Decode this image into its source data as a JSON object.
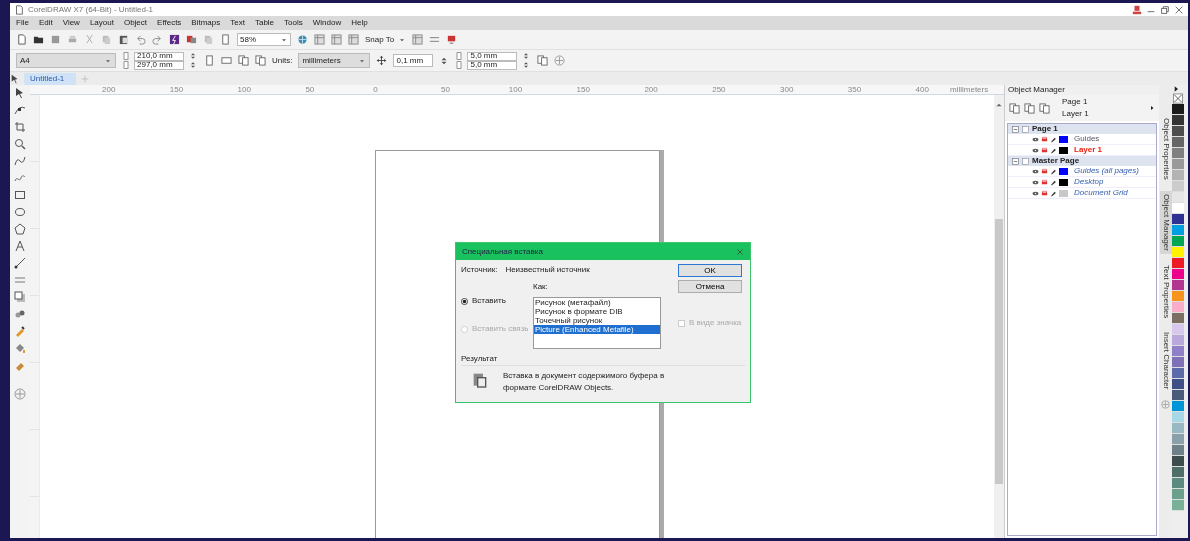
{
  "window": {
    "title": "CorelDRAW X7 (64-Bit) - Untitled-1"
  },
  "menu": [
    "File",
    "Edit",
    "View",
    "Layout",
    "Object",
    "Effects",
    "Bitmaps",
    "Text",
    "Table",
    "Tools",
    "Window",
    "Help"
  ],
  "toolbar": {
    "zoom": "58%",
    "snap_to": "Snap To"
  },
  "property_bar": {
    "page_size": "A4",
    "width": "210,0 mm",
    "height": "297,0 mm",
    "units_label": "Units:",
    "units": "millimeters",
    "nudge": "0,1 mm",
    "duplicate_x": "5,0 mm",
    "duplicate_y": "5,0 mm"
  },
  "document_tabs": [
    {
      "label": "Untitled-1",
      "selected": true
    }
  ],
  "ruler": {
    "labels": [
      "200",
      "150",
      "100",
      "50",
      "0",
      "50",
      "100",
      "150",
      "200",
      "250",
      "300",
      "350",
      "400"
    ],
    "unit": "millimeters"
  },
  "dialog": {
    "title": "Специальная вставка",
    "source_label": "Источник:",
    "source": "Неизвестный источник",
    "as_label": "Как:",
    "options": [
      {
        "label": "Вставить",
        "selected": true,
        "disabled": false
      },
      {
        "label": "Вставить связь",
        "selected": false,
        "disabled": true
      }
    ],
    "formats": [
      {
        "label": "Рисунок (метафайл)",
        "selected": false
      },
      {
        "label": "Рисунок в формате DIB",
        "selected": false
      },
      {
        "label": "Точечный рисунок",
        "selected": false
      },
      {
        "label": "Picture (Enhanced Metafile)",
        "selected": true
      }
    ],
    "as_icon": {
      "label": "В виде значка",
      "checked": false,
      "disabled": true
    },
    "buttons": [
      "OK",
      "Отмена"
    ],
    "result_label": "Результат",
    "result": "Вставка в документ содержимого буфера в формате CorelDRAW Objects."
  },
  "object_manager": {
    "title": "Object Manager",
    "current_page": "Page 1",
    "current_layer": "Layer 1",
    "pages": [
      {
        "name": "Page 1",
        "children": [
          {
            "name": "Guides",
            "kind": "layer",
            "active": false,
            "color": "#0000ff"
          },
          {
            "name": "Layer 1",
            "kind": "layer",
            "active": true,
            "color": "#000000"
          }
        ]
      },
      {
        "name": "Master Page",
        "children": [
          {
            "name": "Guides (all pages)",
            "kind": "master",
            "active": false,
            "color": "#0000ff"
          },
          {
            "name": "Desktop",
            "kind": "master",
            "active": false,
            "color": "#000000"
          },
          {
            "name": "Document Grid",
            "kind": "master",
            "active": false,
            "color": "#c8c8c8"
          }
        ]
      }
    ]
  },
  "docker_tabs": [
    {
      "label": "Object Properties",
      "selected": false
    },
    {
      "label": "Object Manager",
      "selected": true
    },
    {
      "label": "Text Properties",
      "selected": false
    },
    {
      "label": "Insert Character",
      "selected": false
    }
  ],
  "palette": [
    {
      "color": "#1a1a1a"
    },
    {
      "color": "#333333"
    },
    {
      "color": "#4d4d4d"
    },
    {
      "color": "#666666"
    },
    {
      "color": "#808080"
    },
    {
      "color": "#999999"
    },
    {
      "color": "#b3b3b3"
    },
    {
      "color": "#cccccc"
    },
    {
      "color": "#e6e6e6"
    },
    {
      "color": "#ffffff"
    },
    {
      "color": "#2e3192"
    },
    {
      "color": "#00a0e0"
    },
    {
      "color": "#00a651"
    },
    {
      "color": "#fff200"
    },
    {
      "color": "#ed1c24"
    },
    {
      "color": "#ec008c"
    },
    {
      "color": "#b0368f"
    },
    {
      "color": "#f7941d"
    },
    {
      "color": "#f9adc8"
    },
    {
      "color": "#7d6e63"
    },
    {
      "color": "#d8c8ec"
    },
    {
      "color": "#b8a8dc"
    },
    {
      "color": "#9080c8"
    },
    {
      "color": "#8070b8"
    },
    {
      "color": "#5c6aa8"
    },
    {
      "color": "#3e4f86"
    },
    {
      "color": "#4a5a7a"
    },
    {
      "color": "#0095d6"
    },
    {
      "color": "#a8d8e8"
    },
    {
      "color": "#98b8c4"
    },
    {
      "color": "#8aa0aa"
    },
    {
      "color": "#6e8088"
    },
    {
      "color": "#3d4d4d"
    },
    {
      "color": "#4f6e6a"
    },
    {
      "color": "#5c8a7e"
    },
    {
      "color": "#6aa08c"
    },
    {
      "color": "#78b098"
    }
  ]
}
